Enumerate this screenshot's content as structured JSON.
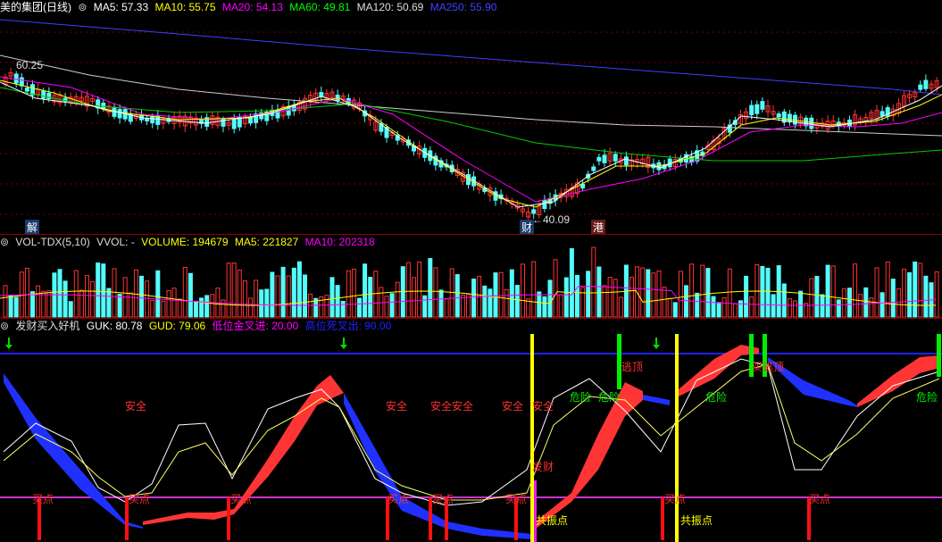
{
  "price": {
    "title": "美的集团(日线)",
    "ma": [
      {
        "label": "MA5: 57.33",
        "color": "#ffffff"
      },
      {
        "label": "MA10: 55.75",
        "color": "#ffff00"
      },
      {
        "label": "MA20: 54.13",
        "color": "#ff00ff"
      },
      {
        "label": "MA60: 49.81",
        "color": "#00ff00"
      },
      {
        "label": "MA120: 50.69",
        "color": "#dddddd"
      },
      {
        "label": "MA250: 55.90",
        "color": "#4040ff"
      }
    ],
    "high_label": "60.25",
    "low_label": "←40.09",
    "markers": [
      "解",
      "财",
      "港"
    ]
  },
  "volume": {
    "title": "VOL-TDX(5,10)",
    "vvol": "VVOL: -",
    "volume": "VOLUME: 194679",
    "ma5": "MA5: 221827",
    "ma10": "MA10: 202318"
  },
  "indicator": {
    "title": "发财买入好机",
    "guk": "GUK: 80.78",
    "gud": "GUD: 79.06",
    "low_cross": "低位金叉进: 20.00",
    "high_cross": "高位死叉出: 90.00",
    "labels": {
      "safe": "安全",
      "safe_double": "安全安全",
      "buy": "买点",
      "danger": "危险",
      "top": "逃顶",
      "top_buy": "买逃顶",
      "resonance": "共振点",
      "fortune": "发财"
    }
  },
  "colors": {
    "up": "#ff3232",
    "down": "#54fcfc",
    "grid": "#8b0000"
  }
}
